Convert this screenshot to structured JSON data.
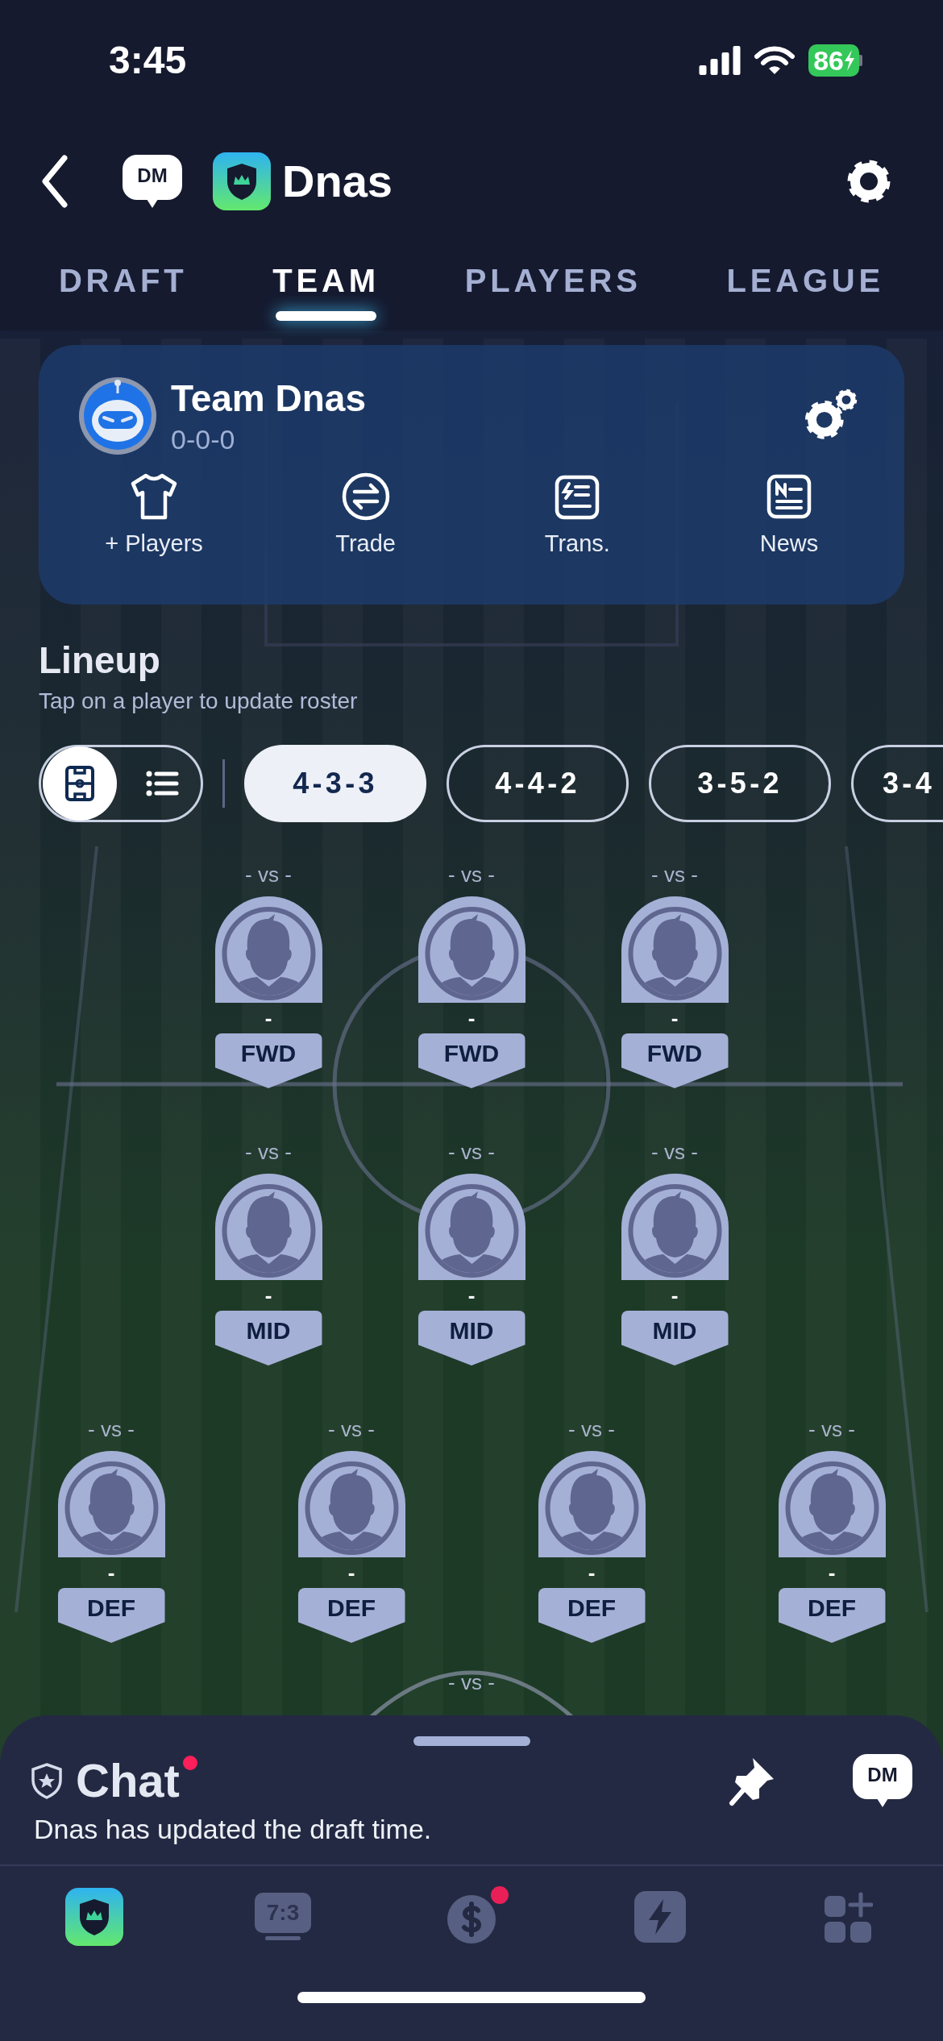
{
  "status_bar": {
    "time": "3:45",
    "battery": "86"
  },
  "header": {
    "dm_badge": "DM",
    "title": "Dnas"
  },
  "tabs": [
    {
      "label": "DRAFT",
      "selected": false
    },
    {
      "label": "TEAM",
      "selected": true
    },
    {
      "label": "PLAYERS",
      "selected": false
    },
    {
      "label": "LEAGUE",
      "selected": false
    }
  ],
  "team_card": {
    "name": "Team Dnas",
    "record": "0-0-0",
    "actions": [
      {
        "kind": "shirt",
        "label": "+ Players"
      },
      {
        "kind": "trade",
        "label": "Trade"
      },
      {
        "kind": "transactions",
        "label": "Trans."
      },
      {
        "kind": "news",
        "label": "News"
      }
    ]
  },
  "lineup": {
    "title": "Lineup",
    "subtitle": "Tap on a player to update roster",
    "view_toggle": [
      {
        "kind": "field",
        "selected": true
      },
      {
        "kind": "list",
        "selected": false
      }
    ],
    "formations": [
      {
        "label": "4-3-3",
        "selected": true
      },
      {
        "label": "4-4-2",
        "selected": false
      },
      {
        "label": "3-5-2",
        "selected": false
      },
      {
        "label": "3-4",
        "selected": false
      }
    ],
    "rows": [
      {
        "players": [
          {
            "opponent": "- vs -",
            "name": "-",
            "position": "FWD"
          },
          {
            "opponent": "- vs -",
            "name": "-",
            "position": "FWD"
          },
          {
            "opponent": "- vs -",
            "name": "-",
            "position": "FWD"
          }
        ]
      },
      {
        "players": [
          {
            "opponent": "- vs -",
            "name": "-",
            "position": "MID"
          },
          {
            "opponent": "- vs -",
            "name": "-",
            "position": "MID"
          },
          {
            "opponent": "- vs -",
            "name": "-",
            "position": "MID"
          }
        ]
      },
      {
        "players": [
          {
            "opponent": "- vs -",
            "name": "-",
            "position": "DEF"
          },
          {
            "opponent": "- vs -",
            "name": "-",
            "position": "DEF"
          },
          {
            "opponent": "- vs -",
            "name": "-",
            "position": "DEF"
          },
          {
            "opponent": "- vs -",
            "name": "-",
            "position": "DEF"
          }
        ]
      }
    ],
    "partial_row_opponent": "- vs -"
  },
  "chat": {
    "title": "Chat",
    "unread": true,
    "message": "Dnas has updated the draft time.",
    "dm_badge": "DM"
  },
  "bottom_nav": [
    {
      "kind": "home",
      "selected": true
    },
    {
      "kind": "scoreboard",
      "label": "7:3",
      "selected": false
    },
    {
      "kind": "money",
      "badge": true,
      "selected": false
    },
    {
      "kind": "bolt",
      "selected": false
    },
    {
      "kind": "apps",
      "selected": false
    }
  ]
}
